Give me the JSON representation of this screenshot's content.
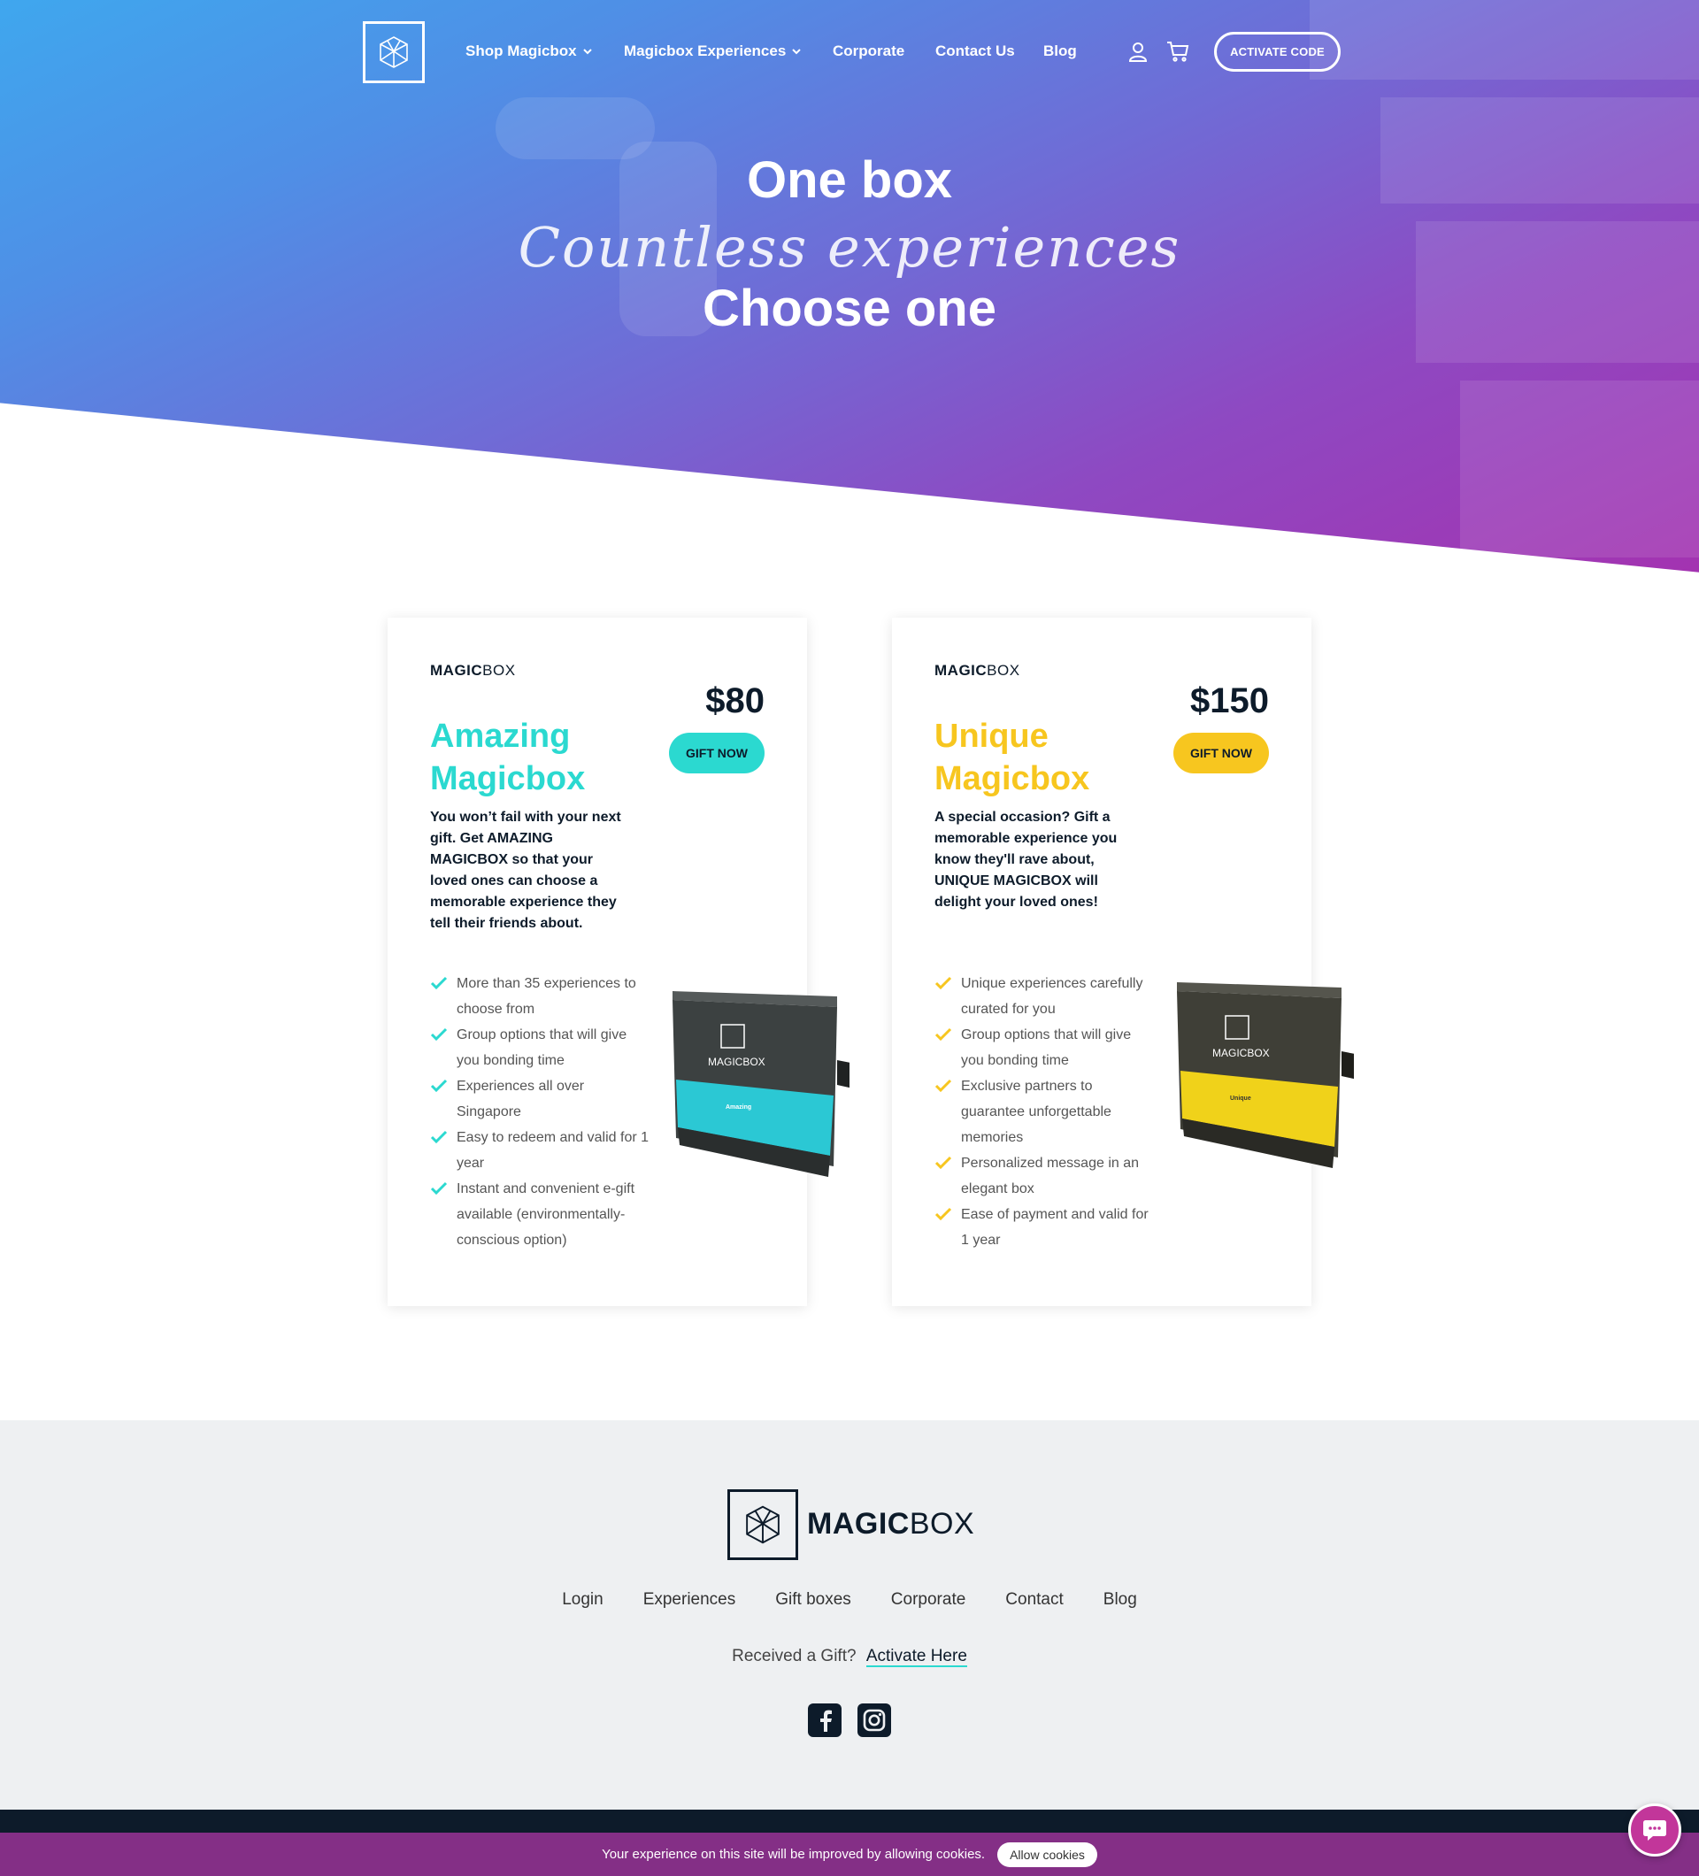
{
  "nav": {
    "items": [
      {
        "label": "Shop Magicbox",
        "has_dropdown": true
      },
      {
        "label": "Magicbox Experiences",
        "has_dropdown": true
      },
      {
        "label": "Corporate",
        "has_dropdown": false
      },
      {
        "label": "Contact Us",
        "has_dropdown": false
      },
      {
        "label": "Blog",
        "has_dropdown": false
      }
    ],
    "icons": [
      "user-icon",
      "cart-icon"
    ],
    "activate_label": "ACTIVATE CODE"
  },
  "hero": {
    "line1": "One box",
    "line2": "Countless experiences",
    "line3": "Choose one"
  },
  "cards": [
    {
      "brand_bold": "MAGIC",
      "brand_light": "BOX",
      "price": "$80",
      "title_line1": "Amazing",
      "title_line2": "Magicbox",
      "accent": "#2bd9d0",
      "button_label": "GIFT NOW",
      "description": "You won’t fail with your next gift. Get AMAZING MAGICBOX so that your loved ones can choose a memorable experience they tell their friends about.",
      "features": [
        "More than 35 experiences to choose from",
        "Group options that will give you bonding time",
        "Experiences all over Singapore",
        "Easy to redeem and valid for 1 year",
        "Instant and convenient e-gift available (environmentally-conscious option)"
      ],
      "box_label": "Amazing"
    },
    {
      "brand_bold": "MAGIC",
      "brand_light": "BOX",
      "price": "$150",
      "title_line1": "Unique",
      "title_line2": "Magicbox",
      "accent": "#f7c61f",
      "button_label": "GIFT NOW",
      "description": "A special occasion? Gift a memorable experience you know they'll rave about, UNIQUE MAGICBOX will delight your loved ones!",
      "features": [
        "Unique experiences carefully curated for you",
        "Group options that will give you bonding time",
        "Exclusive partners to guarantee unforgettable memories",
        "Personalized message in an elegant box",
        "Ease of payment and valid for 1 year"
      ],
      "box_label": "Unique"
    }
  ],
  "footer": {
    "brand_bold": "MAGIC",
    "brand_light": "BOX",
    "links": [
      "Login",
      "Experiences",
      "Gift boxes",
      "Corporate",
      "Contact",
      "Blog"
    ],
    "gift_text": "Received a Gift?",
    "gift_link": "Activate Here",
    "social": [
      "facebook-icon",
      "instagram-icon"
    ]
  },
  "cookie": {
    "text": "Your experience on this site will be improved by allowing cookies.",
    "button_label": "Allow cookies"
  },
  "colors": {
    "navy": "#0d1b2a",
    "teal": "#2bd9d0",
    "yellow": "#f7c61f",
    "purple_bar": "#842f86",
    "chat": "#c2369a"
  }
}
